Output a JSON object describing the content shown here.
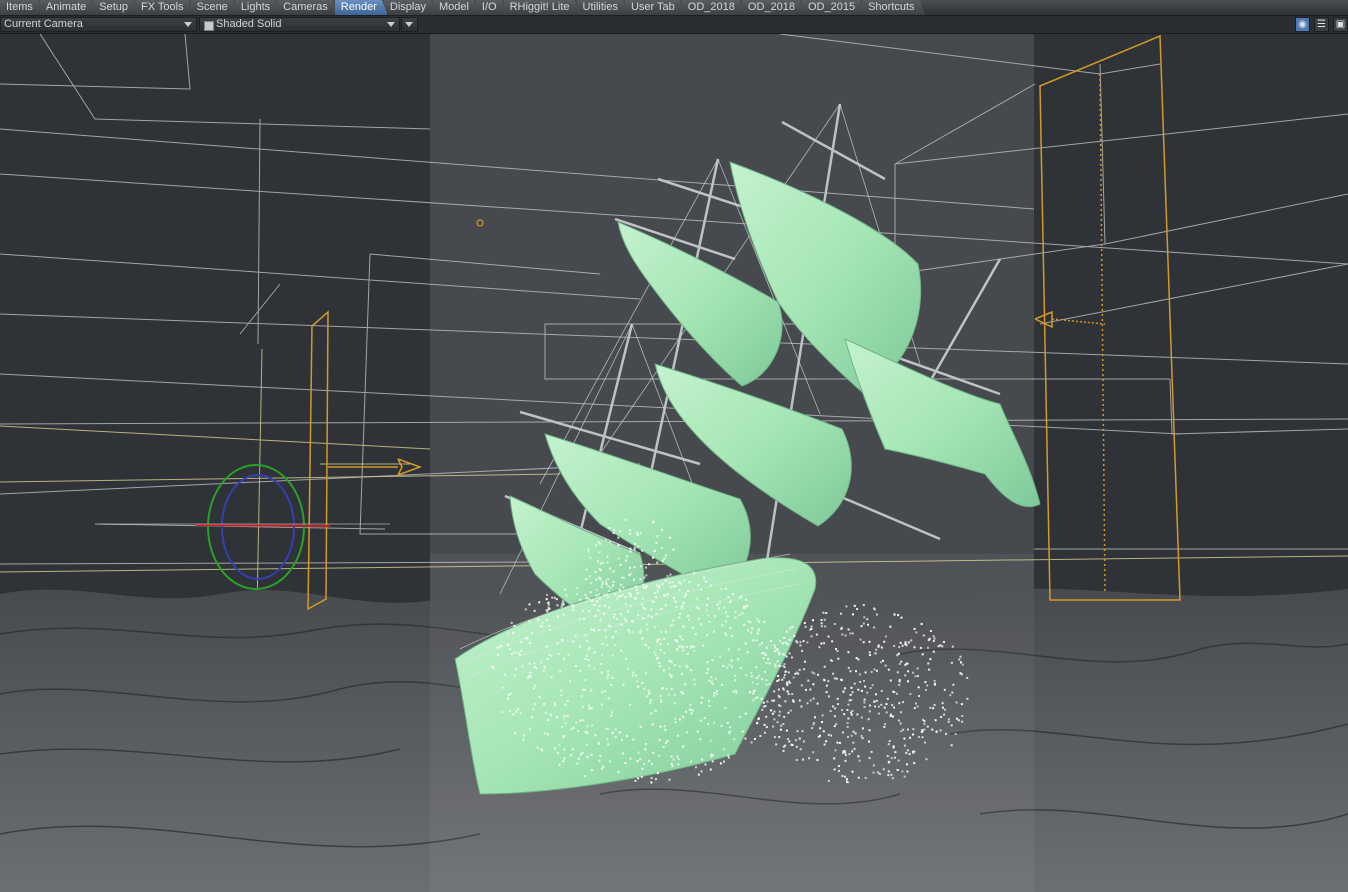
{
  "tabs": [
    {
      "label": "Items",
      "active": false
    },
    {
      "label": "Animate",
      "active": false
    },
    {
      "label": "Setup",
      "active": false
    },
    {
      "label": "FX Tools",
      "active": false
    },
    {
      "label": "Scene",
      "active": false
    },
    {
      "label": "Lights",
      "active": false
    },
    {
      "label": "Cameras",
      "active": false
    },
    {
      "label": "Render",
      "active": true
    },
    {
      "label": "Display",
      "active": false
    },
    {
      "label": "Model",
      "active": false
    },
    {
      "label": "I/O",
      "active": false
    },
    {
      "label": "RHiggit! Lite",
      "active": false
    },
    {
      "label": "Utilities",
      "active": false
    },
    {
      "label": "User Tab",
      "active": false
    },
    {
      "label": "OD_2018",
      "active": false
    },
    {
      "label": "OD_2018",
      "active": false
    },
    {
      "label": "OD_2015",
      "active": false
    },
    {
      "label": "Shortcuts",
      "active": false
    }
  ],
  "viewport": {
    "camera_select": "Current Camera",
    "shading_select": "Shaded Solid",
    "icons": [
      "camera-icon",
      "list-icon",
      "maximize-icon"
    ],
    "colors": {
      "safe_area": "#45484c",
      "letterbox": "#2f3236",
      "wireframe": "#c8cbce",
      "guide_yellow": "#d8d490",
      "light_orange": "#d39a2a",
      "sail_green": "#a6e6b6",
      "ocean": "#56595c",
      "particles": "#ffffff",
      "active_tab": "#4f7ab5"
    }
  }
}
